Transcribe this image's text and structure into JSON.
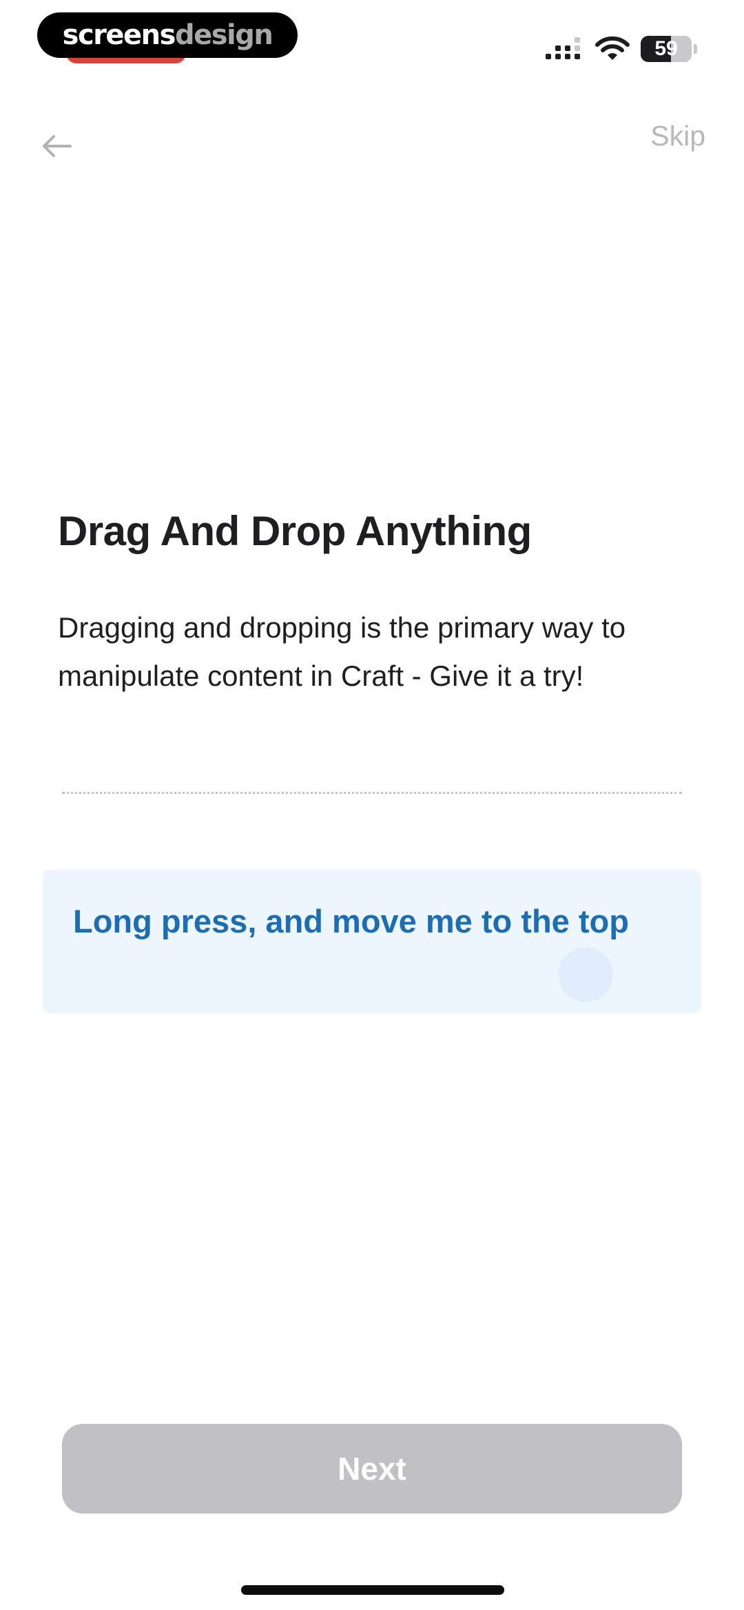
{
  "status_bar": {
    "watermark_part1": "screens",
    "watermark_part2": "design",
    "battery_level": "59",
    "signal_icon": "cellular-signal-icon",
    "wifi_icon": "wifi-icon",
    "recording_color": "#e0403a"
  },
  "nav": {
    "back_icon": "arrow-left-icon",
    "skip_label": "Skip"
  },
  "content": {
    "title": "Drag And Drop Anything",
    "description": "Dragging and dropping is the primary way to manipulate content in Craft - Give it a try!",
    "drag_block_text": "Long press, and move me to the top"
  },
  "footer": {
    "next_label": "Next"
  },
  "colors": {
    "accent": "#1b6eb6",
    "block_background": "#edf5fe",
    "button_disabled": "#c1c0c5",
    "muted_text": "#b7b7bc"
  }
}
